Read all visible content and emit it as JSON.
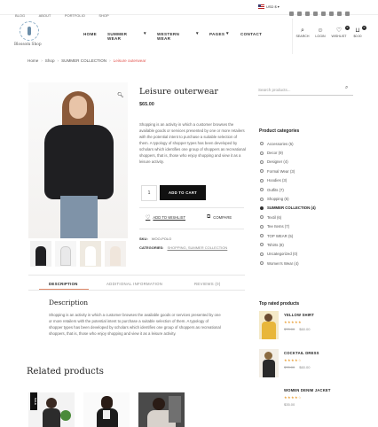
{
  "topbar": {
    "nav": [
      "BLOG",
      "ABOUT",
      "PORTFOLIO",
      "SHOP"
    ],
    "currency": "USD $",
    "social_icons": [
      "facebook-icon",
      "twitter-icon",
      "youtube-icon",
      "instagram-icon",
      "pinterest-icon",
      "vk-icon",
      "telegram-icon",
      "xing-icon"
    ]
  },
  "header": {
    "logo_text": "Blossom Shop",
    "menu": [
      "HOME",
      "SUMMER WEAR",
      "WESTERN WEAR",
      "PAGES",
      "CONTACT"
    ],
    "icons": {
      "search": "SEARCH",
      "login": "LOGIN",
      "wishlist": "WISHLIST",
      "wishlist_count": "0",
      "cart_price": "$0.00",
      "cart_count": "0"
    }
  },
  "breadcrumb": {
    "items": [
      "Home",
      "Shop",
      "SUMMER COLLECTION"
    ],
    "current": "Leisure outerwear"
  },
  "product": {
    "title": "Leisure outerwear",
    "price": "$65.00",
    "description": "Shopping is an activity in which a customer browses the available goods or services presented by one or more retailers with the potential intent to purchase a suitable selection of them. A typology of shopper types has been developed by scholars which identifies one group of shoppers as recreational shoppers, that is, those who enjoy shopping and view it as a leisure activity.",
    "quantity": "1",
    "add_to_cart": "ADD TO CART",
    "wishlist": "ADD TO WISHLIST",
    "compare": "COMPARE",
    "sku_label": "SKU:",
    "sku_value": "WOO-POLO",
    "categories_label": "CATEGORIES:",
    "categories": "SHOPPING, SUMMER COLLECTION"
  },
  "tabs": {
    "items": [
      "DESCRIPTION",
      "ADDITIONAL INFORMATION",
      "REVIEWS (0)"
    ],
    "active": "DESCRIPTION"
  },
  "description_section": {
    "title": "Description",
    "text": "Shopping is an activity in which a customer browses the available goods or services presented by one or more retailers with the potential intent to purchase a suitable selection of them. A typology of shopper types has been developed by scholars which identifies one group of shoppers as recreational shoppers, that is, those who enjoy shopping and view it as a leisure activity."
  },
  "related": {
    "title": "Related products",
    "sale_badge": "SALE"
  },
  "sidebar": {
    "search_placeholder": "Search products...",
    "categories_title": "Product categories",
    "categories": [
      "Accessories (5)",
      "Decor (9)",
      "Designer (4)",
      "Formal Wear (3)",
      "Hoodies (3)",
      "Outfits (7)",
      "Shopping (6)",
      "SUMMER COLLECTION (4)",
      "Textil (6)",
      "Tee Items (7)",
      "TOP WEAR (5)",
      "Tshirts (8)",
      "Uncategorized (0)",
      "Women's Wear (4)"
    ],
    "active_category": "SUMMER COLLECTION (4)",
    "top_rated_title": "Top rated products",
    "top_rated": [
      {
        "name": "YELLOW SHIRT",
        "stars": "★★★★★",
        "old_price": "$70.00",
        "price": "$60.00"
      },
      {
        "name": "COCKTAIL DRESS",
        "stars": "★★★★☆",
        "old_price": "$70.00",
        "price": "$60.00"
      },
      {
        "name": "WOMEN DENIM JACKET",
        "stars": "★★★★☆",
        "old_price": "",
        "price": "$35.00"
      }
    ]
  },
  "colors": {
    "accent": "#e2544e",
    "button": "#111111",
    "star": "#e9a13b"
  }
}
